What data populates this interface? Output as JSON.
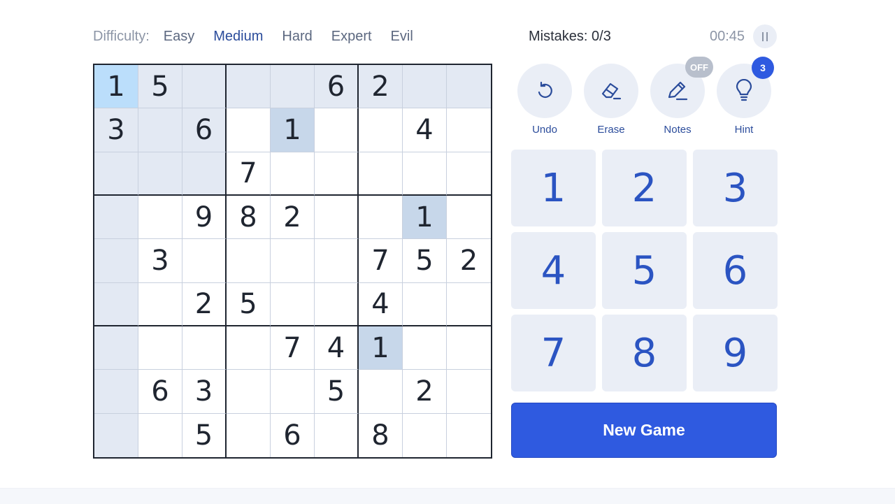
{
  "difficulty": {
    "label": "Difficulty:",
    "options": [
      "Easy",
      "Medium",
      "Hard",
      "Expert",
      "Evil"
    ],
    "selected": "Medium"
  },
  "status": {
    "mistakes": "Mistakes: 0/3",
    "timer": "00:45"
  },
  "board": {
    "rows": [
      [
        "1",
        "5",
        "",
        "",
        "",
        "6",
        "2",
        "",
        ""
      ],
      [
        "3",
        "",
        "6",
        "",
        "1",
        "",
        "",
        "4",
        ""
      ],
      [
        "",
        "",
        "",
        "7",
        "",
        "",
        "",
        "",
        ""
      ],
      [
        "",
        "",
        "9",
        "8",
        "2",
        "",
        "",
        "1",
        ""
      ],
      [
        "",
        "3",
        "",
        "",
        "",
        "",
        "7",
        "5",
        "2"
      ],
      [
        "",
        "",
        "2",
        "5",
        "",
        "",
        "4",
        "",
        ""
      ],
      [
        "",
        "",
        "",
        "",
        "7",
        "4",
        "1",
        "",
        ""
      ],
      [
        "",
        "6",
        "3",
        "",
        "",
        "5",
        "",
        "2",
        ""
      ],
      [
        "",
        "",
        "5",
        "",
        "6",
        "",
        "8",
        "",
        ""
      ]
    ],
    "selected_cell": [
      0,
      0
    ]
  },
  "tools": {
    "undo": "Undo",
    "erase": "Erase",
    "notes": "Notes",
    "notes_state": "OFF",
    "hint": "Hint",
    "hint_count": "3"
  },
  "numpad": [
    "1",
    "2",
    "3",
    "4",
    "5",
    "6",
    "7",
    "8",
    "9"
  ],
  "new_game": "New Game",
  "colors": {
    "accent": "#2f5ae0",
    "number_blue": "#2b54c2",
    "selected_cell": "#bbdefb",
    "peer_cell": "#e3e9f3",
    "same_number": "#c7d7ea",
    "key_bg": "#eaeef6"
  }
}
